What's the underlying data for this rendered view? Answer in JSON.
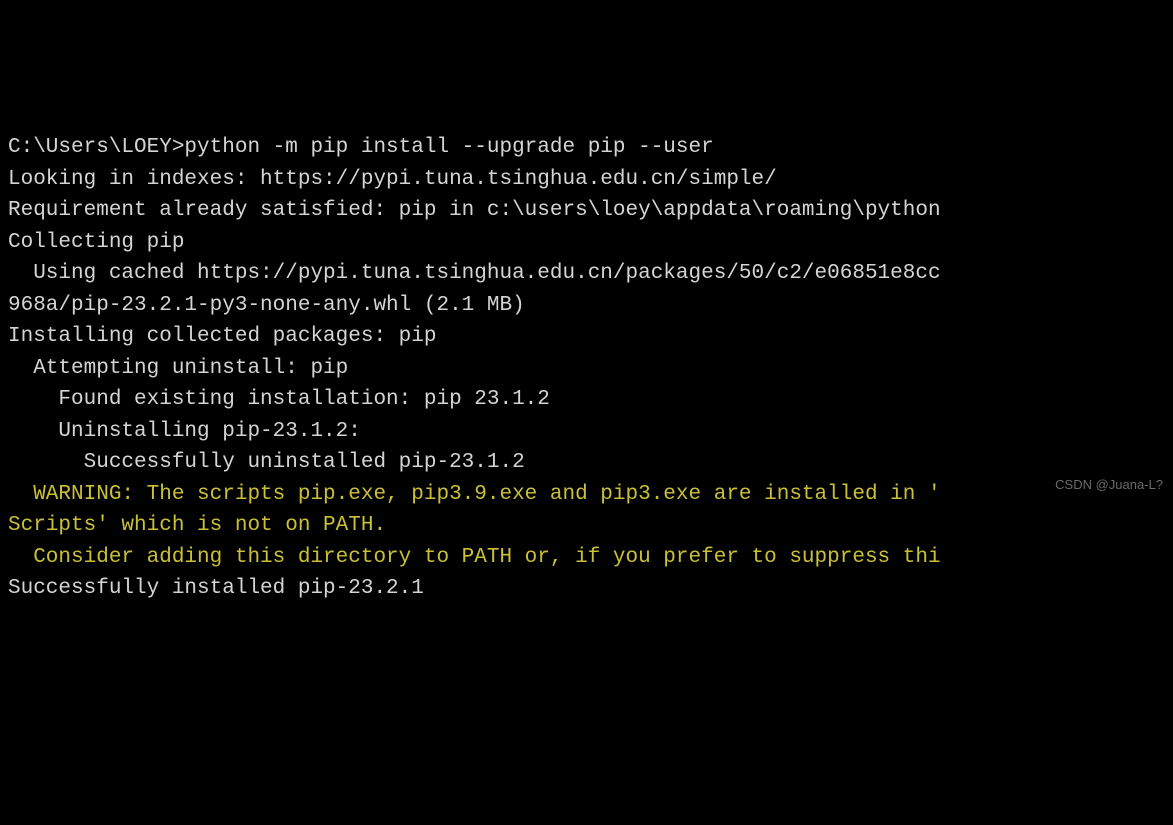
{
  "terminal": {
    "lines": [
      {
        "text": "C:\\Users\\LOEY>python -m pip install --upgrade pip --user",
        "style": "prompt"
      },
      {
        "text": "Looking in indexes: https://pypi.tuna.tsinghua.edu.cn/simple/",
        "style": "normal"
      },
      {
        "text": "Requirement already satisfied: pip in c:\\users\\loey\\appdata\\roaming\\python",
        "style": "normal"
      },
      {
        "text": "Collecting pip",
        "style": "normal"
      },
      {
        "text": "  Using cached https://pypi.tuna.tsinghua.edu.cn/packages/50/c2/e06851e8cc",
        "style": "normal"
      },
      {
        "text": "968a/pip-23.2.1-py3-none-any.whl (2.1 MB)",
        "style": "normal"
      },
      {
        "text": "Installing collected packages: pip",
        "style": "normal"
      },
      {
        "text": "  Attempting uninstall: pip",
        "style": "normal"
      },
      {
        "text": "    Found existing installation: pip 23.1.2",
        "style": "normal"
      },
      {
        "text": "    Uninstalling pip-23.1.2:",
        "style": "normal"
      },
      {
        "text": "      Successfully uninstalled pip-23.1.2",
        "style": "normal"
      },
      {
        "text": "  WARNING: The scripts pip.exe, pip3.9.exe and pip3.exe are installed in '",
        "style": "warning"
      },
      {
        "text": "Scripts' which is not on PATH.",
        "style": "warning"
      },
      {
        "text": "  Consider adding this directory to PATH or, if you prefer to suppress thi",
        "style": "warning"
      },
      {
        "text": "Successfully installed pip-23.2.1",
        "style": "normal"
      }
    ]
  },
  "watermark": "CSDN @Juana-L?"
}
